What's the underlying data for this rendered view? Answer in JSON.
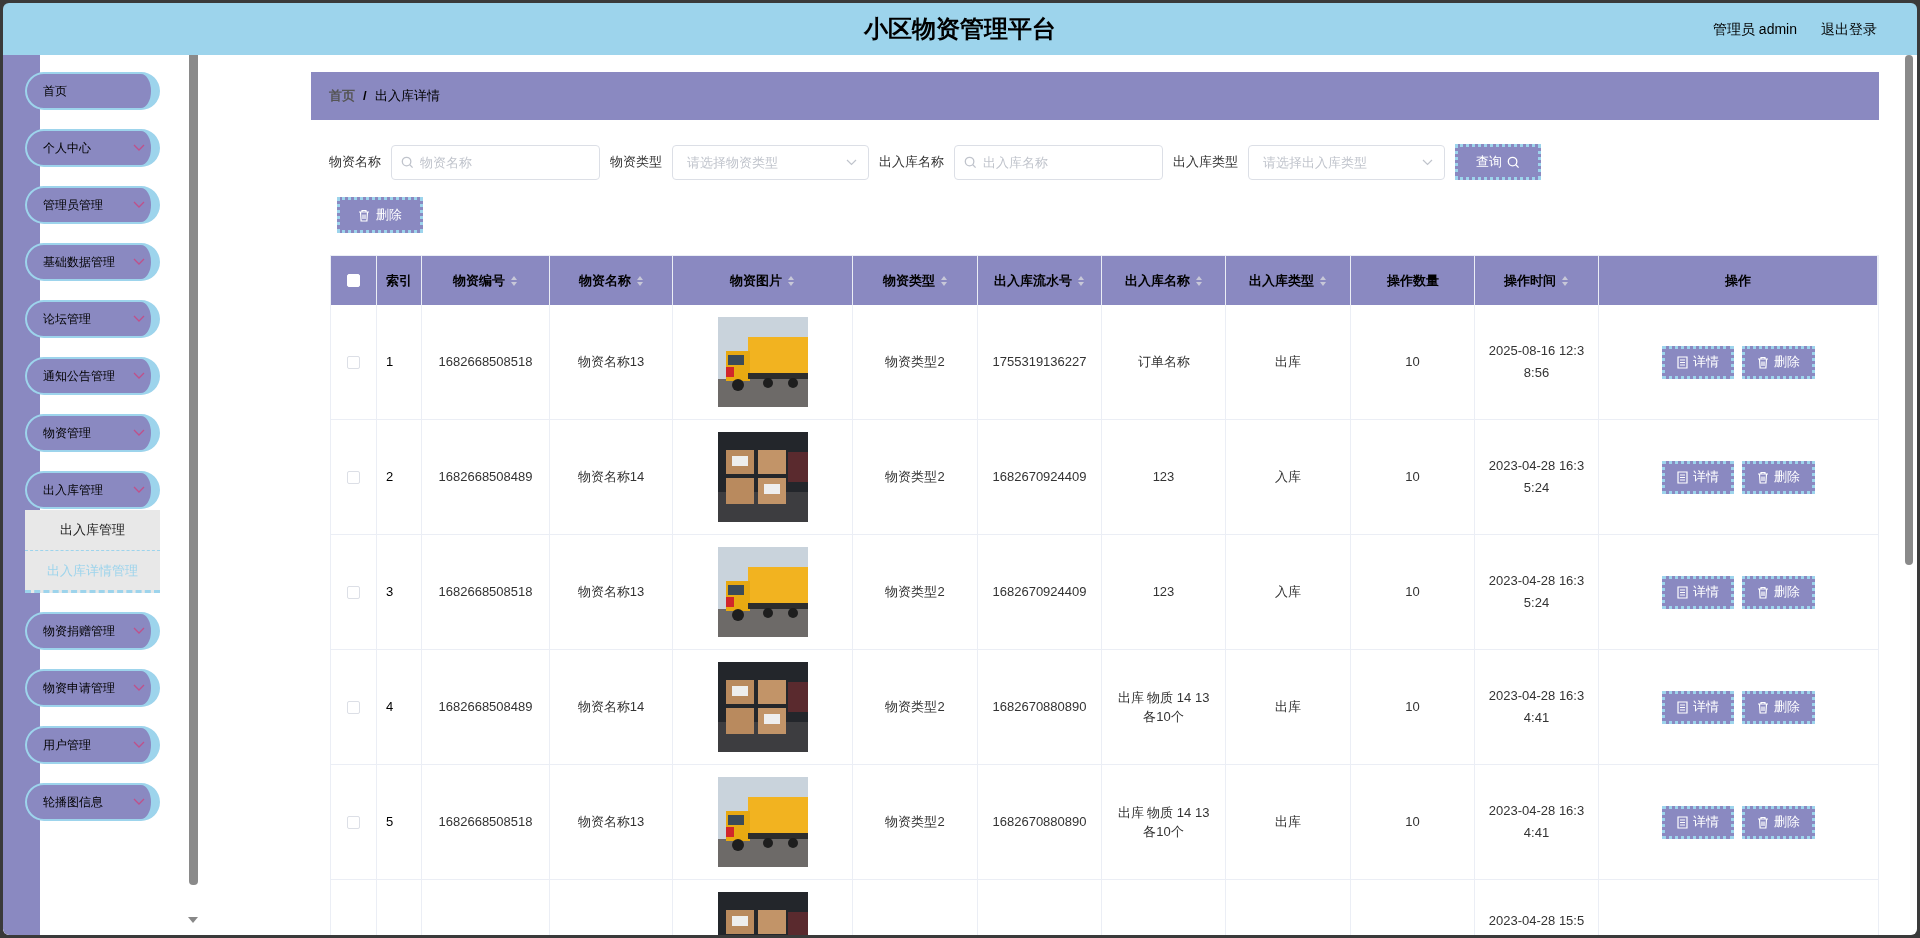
{
  "header": {
    "title": "小区物资管理平台",
    "user": "管理员 admin",
    "logout": "退出登录"
  },
  "sidebar": {
    "items": [
      {
        "label": "首页",
        "has_children": false
      },
      {
        "label": "个人中心",
        "has_children": true
      },
      {
        "label": "管理员管理",
        "has_children": true
      },
      {
        "label": "基础数据管理",
        "has_children": true
      },
      {
        "label": "论坛管理",
        "has_children": true
      },
      {
        "label": "通知公告管理",
        "has_children": true
      },
      {
        "label": "物资管理",
        "has_children": true
      },
      {
        "label": "出入库管理",
        "has_children": true,
        "children": [
          {
            "label": "出入库管理",
            "selected": false
          },
          {
            "label": "出入库详情管理",
            "selected": true
          }
        ]
      },
      {
        "label": "物资捐赠管理",
        "has_children": true
      },
      {
        "label": "物资申请管理",
        "has_children": true
      },
      {
        "label": "用户管理",
        "has_children": true
      },
      {
        "label": "轮播图信息",
        "has_children": true
      }
    ]
  },
  "breadcrumb": [
    "首页",
    "出入库详情"
  ],
  "breadcrumb_separator": "/",
  "filters": [
    {
      "kind": "input",
      "label": "物资名称",
      "placeholder": "物资名称"
    },
    {
      "kind": "select",
      "label": "物资类型",
      "placeholder": "请选择物资类型"
    },
    {
      "kind": "input",
      "label": "出入库名称",
      "placeholder": "出入库名称"
    },
    {
      "kind": "select",
      "label": "出入库类型",
      "placeholder": "请选择出入库类型"
    }
  ],
  "search_button": "查询",
  "delete_button": "删除",
  "table": {
    "select_all_checked": false,
    "columns": [
      {
        "label": "索引",
        "sortable": false
      },
      {
        "label": "物资编号",
        "sortable": true
      },
      {
        "label": "物资名称",
        "sortable": true
      },
      {
        "label": "物资图片",
        "sortable": true
      },
      {
        "label": "物资类型",
        "sortable": true
      },
      {
        "label": "出入库流水号",
        "sortable": true
      },
      {
        "label": "出入库名称",
        "sortable": true
      },
      {
        "label": "出入库类型",
        "sortable": true
      },
      {
        "label": "操作数量",
        "sortable": false
      },
      {
        "label": "操作时间",
        "sortable": true
      },
      {
        "label": "操作",
        "sortable": false
      }
    ],
    "rows": [
      {
        "checked": false,
        "index": "1",
        "code": "1682668508518",
        "name": "物资名称13",
        "type": "物资类型2",
        "serial": "1755319136227",
        "io_name": "订单名称",
        "io_type": "出库",
        "qty": "10",
        "time": "2025-08-16 12:38:56",
        "actions": [
          "详情",
          "删除"
        ]
      },
      {
        "checked": false,
        "index": "2",
        "code": "1682668508489",
        "name": "物资名称14",
        "type": "物资类型2",
        "serial": "1682670924409",
        "io_name": "123",
        "io_type": "入库",
        "qty": "10",
        "time": "2023-04-28 16:35:24",
        "actions": [
          "详情",
          "删除"
        ]
      },
      {
        "checked": false,
        "index": "3",
        "code": "1682668508518",
        "name": "物资名称13",
        "type": "物资类型2",
        "serial": "1682670924409",
        "io_name": "123",
        "io_type": "入库",
        "qty": "10",
        "time": "2023-04-28 16:35:24",
        "actions": [
          "详情",
          "删除"
        ]
      },
      {
        "checked": false,
        "index": "4",
        "code": "1682668508489",
        "name": "物资名称14",
        "type": "物资类型2",
        "serial": "1682670880890",
        "io_name": "出库 物质 14 13 各10个",
        "io_type": "出库",
        "qty": "10",
        "time": "2023-04-28 16:34:41",
        "actions": [
          "详情",
          "删除"
        ]
      },
      {
        "checked": false,
        "index": "5",
        "code": "1682668508518",
        "name": "物资名称13",
        "type": "物资类型2",
        "serial": "1682670880890",
        "io_name": "出库 物质 14 13 各10个",
        "io_type": "出库",
        "qty": "10",
        "time": "2023-04-28 16:34:41",
        "actions": [
          "详情",
          "删除"
        ]
      },
      {
        "time": "2023-04-28 15:5"
      }
    ]
  }
}
